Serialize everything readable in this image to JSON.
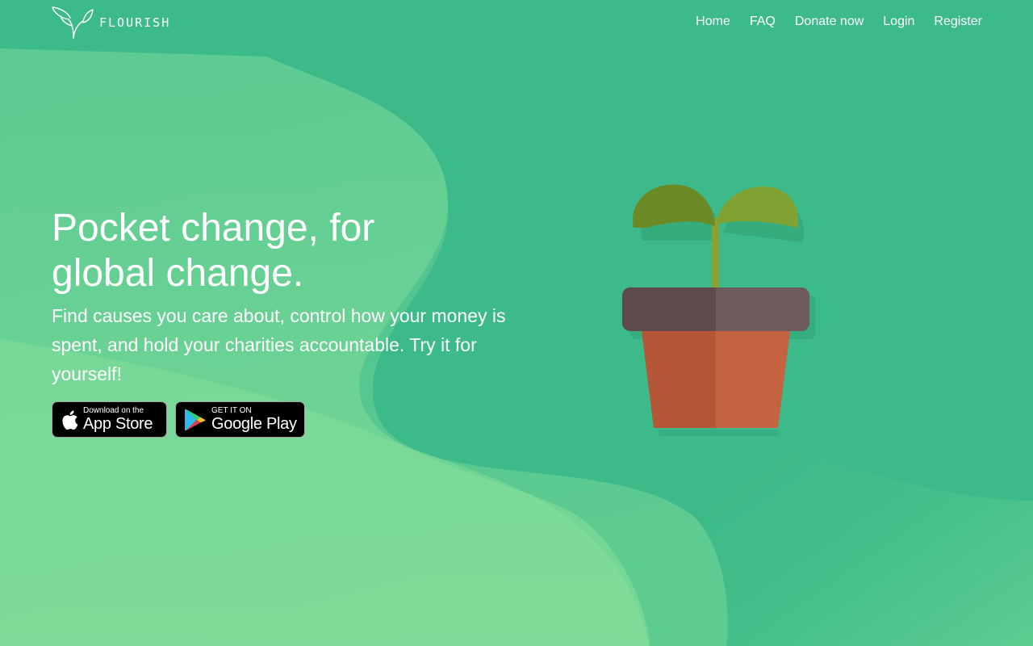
{
  "brand": {
    "name": "FLOURISH",
    "logo_icon": "sprout-leaves-icon"
  },
  "nav": {
    "items": [
      {
        "label": "Home"
      },
      {
        "label": "FAQ"
      },
      {
        "label": "Donate now"
      },
      {
        "label": "Login"
      },
      {
        "label": "Register"
      }
    ]
  },
  "hero": {
    "title_line1": "Pocket change, for",
    "title_line2": "global change.",
    "subtitle": "Find causes you care about, control how your money is spent, and hold your charities accountable. Try it for yourself!"
  },
  "badges": {
    "app_store": {
      "small": "Download on the",
      "big": "App Store",
      "icon": "apple-icon"
    },
    "google_play": {
      "small": "GET IT ON",
      "big": "Google Play",
      "icon": "google-play-icon"
    }
  },
  "illustration": {
    "name": "potted-sprout-illustration"
  },
  "colors": {
    "background": "#3cba89",
    "background_light": "#86e09d",
    "leaf_left": "#6b8a26",
    "leaf_right": "#7fa131",
    "pot_rim": "#6e5b5c",
    "pot_body": "#c4633f"
  }
}
